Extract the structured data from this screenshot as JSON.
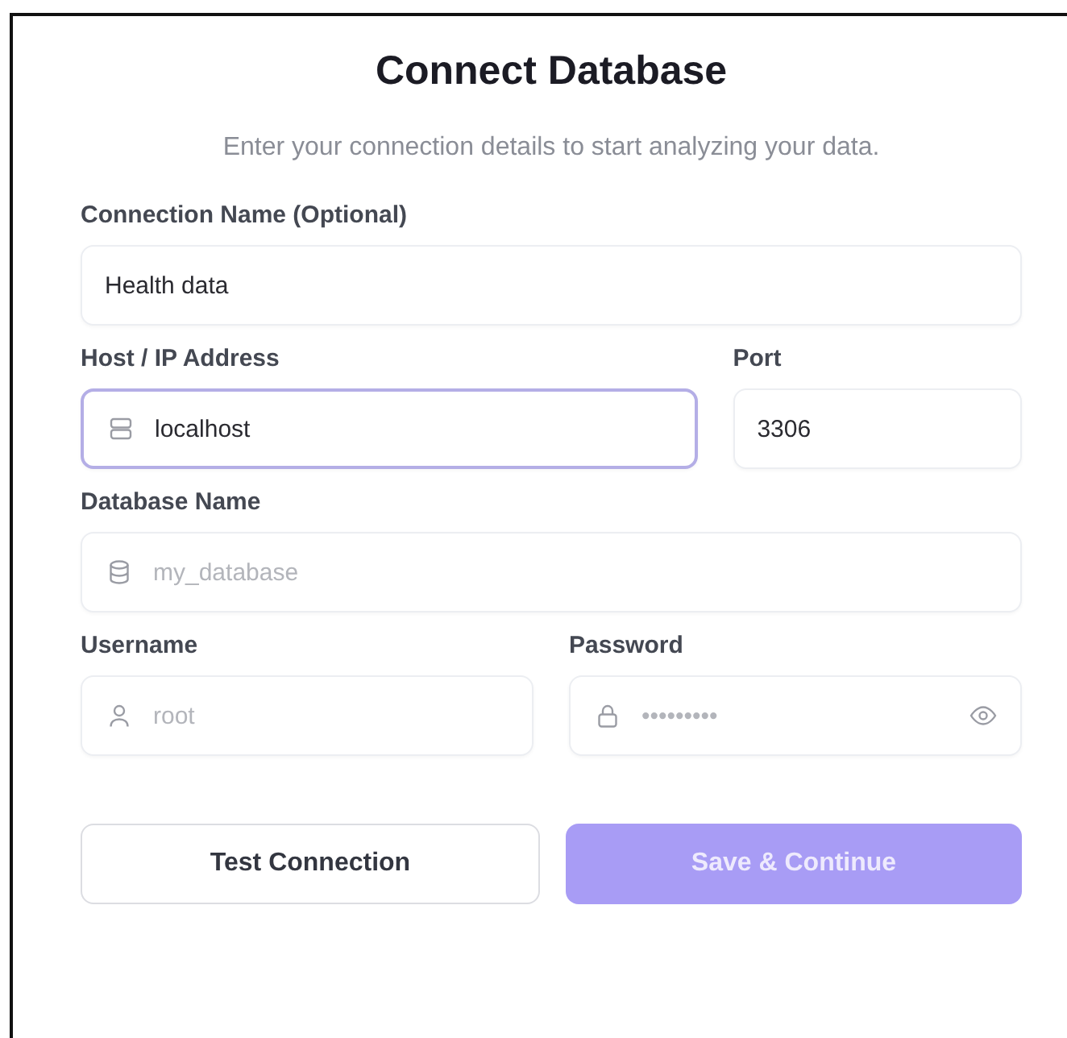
{
  "title": "Connect Database",
  "subtitle": "Enter your connection details to start analyzing your data.",
  "rows": [
    {
      "fields": [
        {
          "kind": "name",
          "label": "Connection Name (Optional)",
          "value": "Health data",
          "focused": false
        }
      ]
    },
    {
      "fields": [
        {
          "kind": "host",
          "label": "Host / IP Address",
          "value": "localhost",
          "focused": true
        },
        {
          "kind": "port",
          "label": "Port",
          "value": "3306",
          "focused": false
        }
      ]
    },
    {
      "fields": [
        {
          "kind": "database",
          "label": "Database Name",
          "placeholder": "my_database",
          "focused": false
        }
      ]
    },
    {
      "fields": [
        {
          "kind": "username",
          "label": "Username",
          "placeholder": "root",
          "focused": false
        },
        {
          "kind": "password",
          "label": "Password",
          "placeholder": "•••••••••",
          "focused": false
        }
      ]
    }
  ],
  "buttons": [
    {
      "label": "Test Connection",
      "kind": "secondary",
      "disabled": false
    },
    {
      "label": "Save & Continue",
      "kind": "primary",
      "disabled": true
    }
  ]
}
